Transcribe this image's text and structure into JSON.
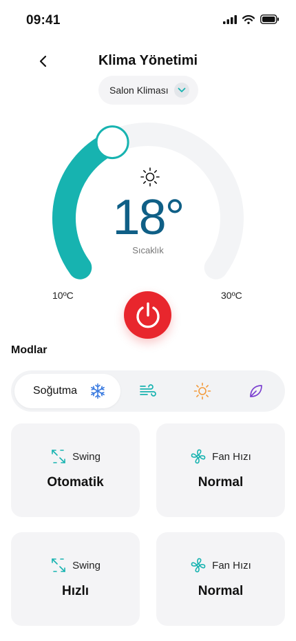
{
  "status": {
    "time": "09:41",
    "icons": [
      "signal-icon",
      "wifi-icon",
      "battery-icon"
    ]
  },
  "header": {
    "title": "Klima Yönetimi",
    "back_icon": "chevron-left-icon"
  },
  "device": {
    "selected": "Salon Kliması",
    "icon": "chevron-down-icon"
  },
  "thermostat": {
    "temperature": "18°",
    "caption": "Sıcaklık",
    "min_label": "10ºC",
    "max_label": "30ºC",
    "level_fraction": 0.4,
    "mode_icon": "sun-icon"
  },
  "power": {
    "icon": "power-icon"
  },
  "modes": {
    "title": "Modlar",
    "active_label": "Soğutma",
    "items": [
      {
        "icon": "snowflake-icon",
        "active": true
      },
      {
        "icon": "wind-icon"
      },
      {
        "icon": "sun-icon"
      },
      {
        "icon": "leaf-icon"
      }
    ]
  },
  "cards": [
    {
      "label": "Swing",
      "value": "Otomatik",
      "icon": "swing-icon"
    },
    {
      "label": "Fan Hızı",
      "value": "Normal",
      "icon": "fan-icon"
    },
    {
      "label": "Swing",
      "value": "Hızlı",
      "icon": "swing-icon"
    },
    {
      "label": "Fan Hızı",
      "value": "Normal",
      "icon": "fan-icon"
    }
  ],
  "colors": {
    "accent": "#17b3b0",
    "power": "#e8262d",
    "temp_text": "#0f5f86",
    "snowflake": "#3b7be0",
    "wind": "#17b3b0",
    "sun": "#f39a3a",
    "leaf": "#7b3fd0"
  }
}
